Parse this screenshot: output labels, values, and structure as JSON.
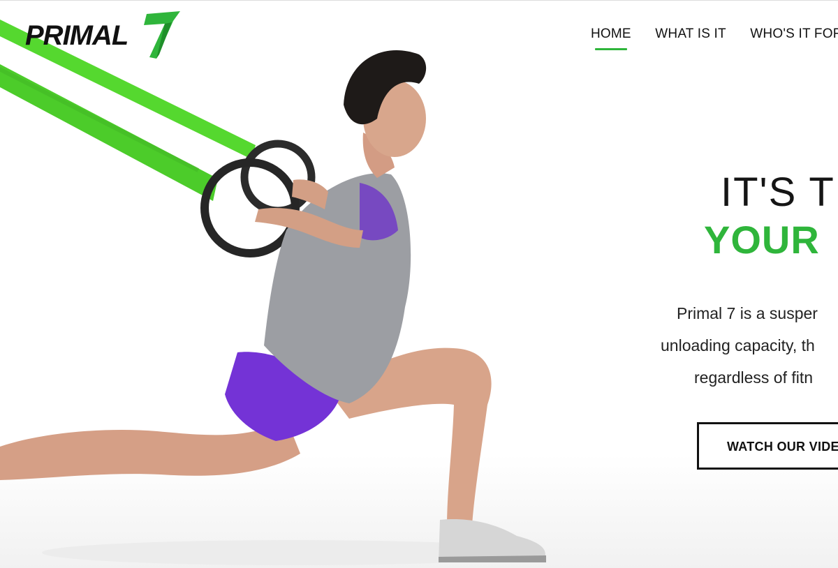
{
  "brand": {
    "name": "PRIMAL",
    "mark": "7",
    "accent_color": "#2fb53b"
  },
  "nav": {
    "items": [
      {
        "label": "HOME",
        "active": true
      },
      {
        "label": "WHAT IS IT",
        "active": false
      },
      {
        "label": "WHO'S IT FOR",
        "active": false
      }
    ]
  },
  "hero": {
    "image": "athlete-lunge-with-suspension-rings",
    "headline_line1": "IT'S TI",
    "headline_line2": "YOUR",
    "description": [
      "Primal 7 is a susper",
      "unloading capacity, th",
      "regardless of fitn"
    ],
    "cta_label": "WATCH OUR VIDE"
  }
}
